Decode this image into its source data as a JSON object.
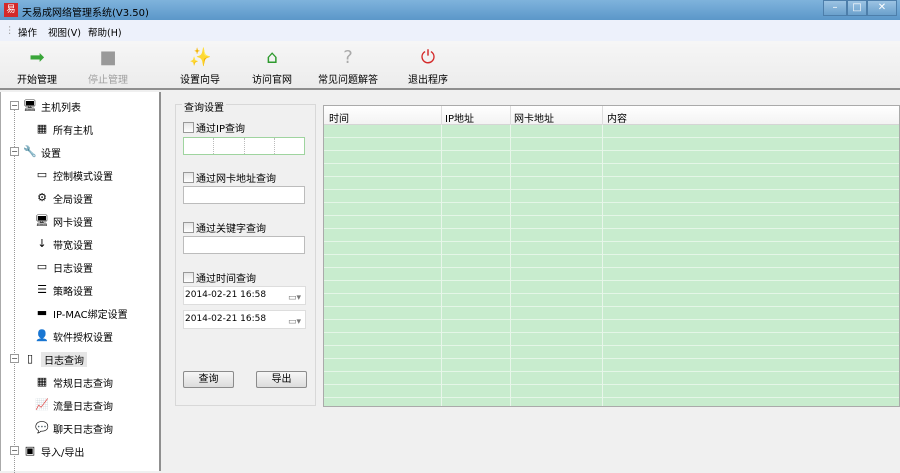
{
  "window": {
    "title": "天易成网络管理系统(V3.50)",
    "logo": "易",
    "minimize": "–",
    "maximize": "□",
    "close": "✕"
  },
  "menu": [
    "操作",
    "视图(V)",
    "帮助(H)"
  ],
  "toolbar": [
    {
      "label": "开始管理",
      "icon": "arrow-right-icon",
      "glyph": "➡",
      "enabled": true
    },
    {
      "label": "停止管理",
      "icon": "stop-icon",
      "glyph": "■",
      "enabled": false
    },
    {
      "label": "设置向导",
      "icon": "wizard-wand-icon",
      "glyph": "✨",
      "enabled": true
    },
    {
      "label": "访问官网",
      "icon": "home-icon",
      "glyph": "⌂",
      "enabled": true
    },
    {
      "label": "常见问题解答",
      "icon": "faq-icon",
      "glyph": "?",
      "enabled": true
    },
    {
      "label": "退出程序",
      "icon": "power-icon",
      "glyph": "⏻",
      "enabled": true
    }
  ],
  "tree": [
    {
      "label": "主机列表",
      "level": 0,
      "glyph": "🖥"
    },
    {
      "label": "所有主机",
      "level": 1,
      "glyph": "▦"
    },
    {
      "label": "设置",
      "level": 0,
      "glyph": "🔧"
    },
    {
      "label": "控制模式设置",
      "level": 1,
      "glyph": "▭"
    },
    {
      "label": "全局设置",
      "level": 1,
      "glyph": "⚙"
    },
    {
      "label": "网卡设置",
      "level": 1,
      "glyph": "🖥"
    },
    {
      "label": "带宽设置",
      "level": 1,
      "glyph": "↓"
    },
    {
      "label": "日志设置",
      "level": 1,
      "glyph": "▭"
    },
    {
      "label": "策略设置",
      "level": 1,
      "glyph": "☰"
    },
    {
      "label": "IP-MAC绑定设置",
      "level": 1,
      "glyph": "▬"
    },
    {
      "label": "软件授权设置",
      "level": 1,
      "glyph": "👤"
    },
    {
      "label": "日志查询",
      "level": 0,
      "glyph": "▯",
      "selected": true
    },
    {
      "label": "常规日志查询",
      "level": 1,
      "glyph": "▦"
    },
    {
      "label": "流量日志查询",
      "level": 1,
      "glyph": "📈"
    },
    {
      "label": "聊天日志查询",
      "level": 1,
      "glyph": "💬"
    },
    {
      "label": "导入/导出",
      "level": 0,
      "glyph": "▣"
    }
  ],
  "query": {
    "group_title": "查询设置",
    "by_ip": "通过IP查询",
    "by_mac": "通过网卡地址查询",
    "by_keyword": "通过关键字查询",
    "by_time": "通过时间查询",
    "start_time": "2014-02-21 16:58",
    "end_time": "2014-02-21 16:58",
    "query_button": "查询",
    "export_button": "导出"
  },
  "table": {
    "columns": [
      "时间",
      "IP地址",
      "网卡地址",
      "内容"
    ],
    "row_color": "#c8ecce"
  }
}
